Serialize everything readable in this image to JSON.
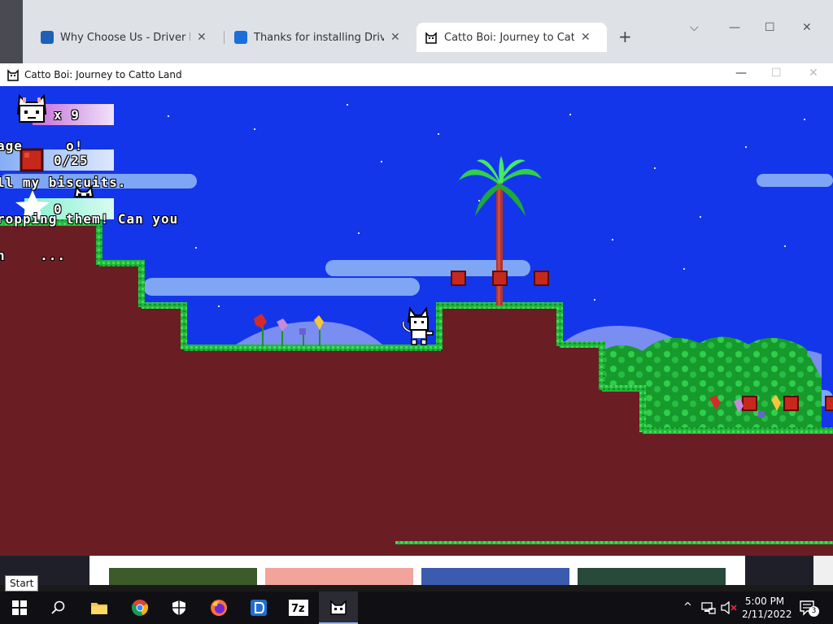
{
  "browser": {
    "tabs": [
      {
        "title": "Why Choose Us - Driver Easy",
        "active": false
      },
      {
        "title": "Thanks for installing Driver Booster",
        "active": false
      },
      {
        "title": "Catto Boi: Journey to Catto Land",
        "active": true
      }
    ],
    "new_tab": "+",
    "window_controls": {
      "dropdown": "⌵",
      "minimize": "—",
      "maximize": "☐",
      "close": "✕"
    }
  },
  "game_window": {
    "title": "Catto Boi: Journey to Catto Land",
    "controls": {
      "minimize": "—",
      "maximize": "☐",
      "close": "✕"
    }
  },
  "hud": {
    "lives_text": "x 9",
    "biscuits_text": "0/25",
    "stars_text": "0"
  },
  "dialogue": {
    "lines": [
      "age     o!",
      "ll my biscuits.",
      "ropping them! Can you",
      "n    ..."
    ]
  },
  "taskbar": {
    "start_tooltip": "Start",
    "time": "5:00 PM",
    "date": "2/11/2022",
    "notification_count": "3",
    "apps": [
      {
        "name": "windows-start",
        "label": "Start"
      },
      {
        "name": "search",
        "label": "Search"
      },
      {
        "name": "file-explorer",
        "label": "File Explorer"
      },
      {
        "name": "chrome",
        "label": "Google Chrome"
      },
      {
        "name": "windows-security",
        "label": "Windows Security"
      },
      {
        "name": "firefox",
        "label": "Firefox"
      },
      {
        "name": "driver-easy",
        "label": "Driver Easy"
      },
      {
        "name": "7zip",
        "label": "7-Zip"
      },
      {
        "name": "catto-boi",
        "label": "Catto Boi"
      }
    ]
  },
  "colors": {
    "sky": "#1438ec",
    "ground": "#6a1e24",
    "grass": "#2ecc40",
    "biscuit": "#c0281c"
  }
}
